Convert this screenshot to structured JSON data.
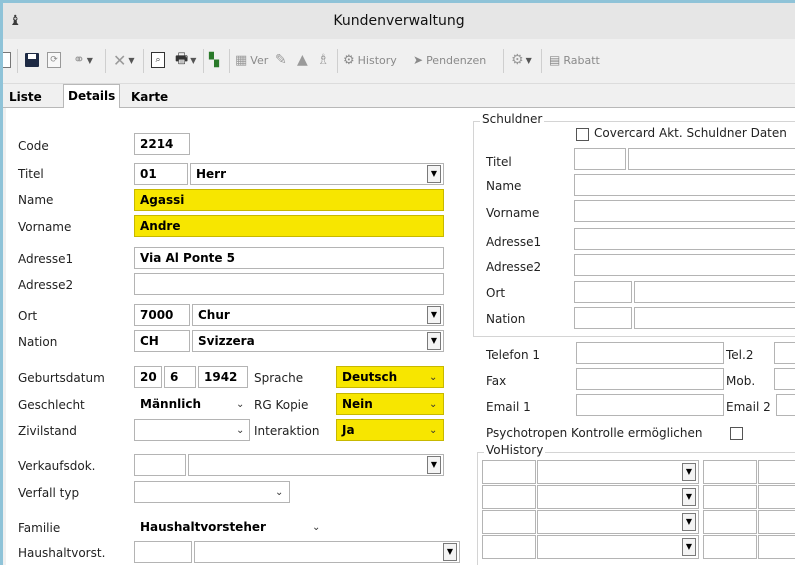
{
  "window": {
    "title": "Kundenverwaltung",
    "app_icon": "app-icon"
  },
  "toolbar": {
    "ver_label": "Ver",
    "history_label": "History",
    "pendenzen_label": "Pendenzen",
    "rabatt_label": "Rabatt",
    "icons": [
      "new-icon",
      "save-icon",
      "copy-icon",
      "find-icon",
      "delete-icon",
      "preview-icon",
      "print-icon",
      "export-icon",
      "users-icon",
      "pen-icon",
      "warning-icon",
      "pin-icon",
      "history-icon",
      "pendenzen-icon",
      "gear-icon",
      "rabatt-icon"
    ]
  },
  "tabs": [
    {
      "label": "Liste"
    },
    {
      "label": "Details",
      "active": true
    },
    {
      "label": "Karte"
    }
  ],
  "form": {
    "code": {
      "label": "Code",
      "value": "2214"
    },
    "titel": {
      "label": "Titel",
      "code": "01",
      "value": "Herr"
    },
    "name": {
      "label": "Name",
      "value": "Agassi"
    },
    "vorname": {
      "label": "Vorname",
      "value": "Andre"
    },
    "adresse1": {
      "label": "Adresse1",
      "value": "Via Al Ponte 5"
    },
    "adresse2": {
      "label": "Adresse2",
      "value": ""
    },
    "ort": {
      "label": "Ort",
      "plz": "7000",
      "value": "Chur"
    },
    "nation": {
      "label": "Nation",
      "code": "CH",
      "value": "Svizzera"
    },
    "geburtsdatum": {
      "label": "Geburtsdatum",
      "day": "20",
      "month": "6",
      "year": "1942"
    },
    "sprache": {
      "label": "Sprache",
      "value": "Deutsch"
    },
    "geschlecht": {
      "label": "Geschlecht",
      "value": "Männlich"
    },
    "rg_kopie": {
      "label": "RG Kopie",
      "value": "Nein"
    },
    "zivilstand": {
      "label": "Zivilstand",
      "value": ""
    },
    "interaktion": {
      "label": "Interaktion",
      "value": "Ja"
    },
    "verkaufsdok": {
      "label": "Verkaufsdok.",
      "value": ""
    },
    "verfall_typ": {
      "label": "Verfall typ",
      "value": ""
    },
    "familie": {
      "label": "Familie",
      "value": "Haushaltvorsteher"
    },
    "haushaltvorst": {
      "label": "Haushaltvorst.",
      "value": ""
    }
  },
  "schuldner": {
    "group_label": "Schuldner",
    "covercard_label": "Covercard Akt. Schuldner Daten",
    "titel_label": "Titel",
    "name_label": "Name",
    "vorname_label": "Vorname",
    "adresse1_label": "Adresse1",
    "adresse2_label": "Adresse2",
    "ort_label": "Ort",
    "nation_label": "Nation"
  },
  "contact": {
    "telefon1_label": "Telefon 1",
    "tel2_label": "Tel.2",
    "fax_label": "Fax",
    "mob_label": "Mob.",
    "email1_label": "Email 1",
    "email2_label": "Email 2",
    "psychotropen_label": "Psychotropen Kontrolle ermöglichen"
  },
  "vohistory": {
    "group_label": "VoHistory"
  }
}
